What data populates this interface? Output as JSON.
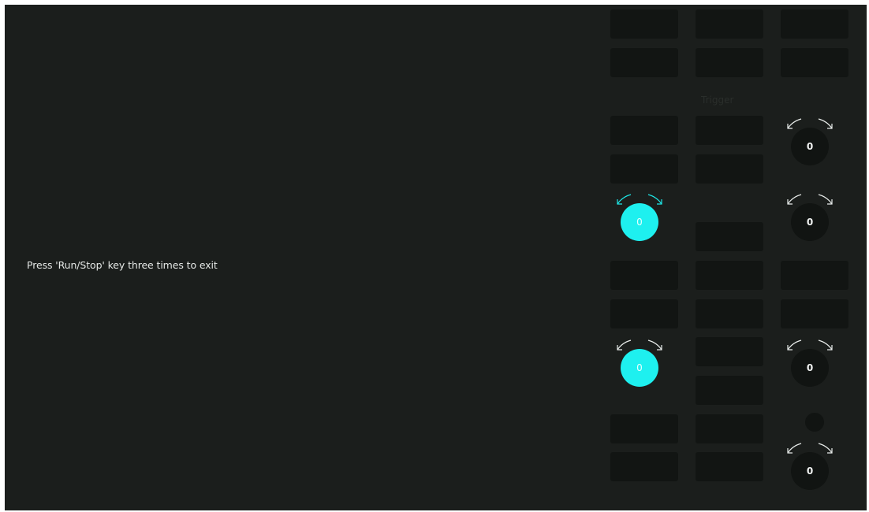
{
  "screen": {
    "exit_hint": "Press 'Run/Stop' key three times to exit"
  },
  "panel": {
    "trigger_label": "Trigger",
    "knobs": [
      {
        "value": "0",
        "active": false
      },
      {
        "value": "0",
        "active": true
      },
      {
        "value": "0",
        "active": false
      },
      {
        "value": "0",
        "active": true
      },
      {
        "value": "0",
        "active": false
      },
      {
        "value": "0",
        "active": false
      }
    ]
  },
  "colors": {
    "background": "#1b1e1c",
    "key": "#121513",
    "knob_active": "#1ef0ef",
    "text": "#e4e7e5"
  }
}
